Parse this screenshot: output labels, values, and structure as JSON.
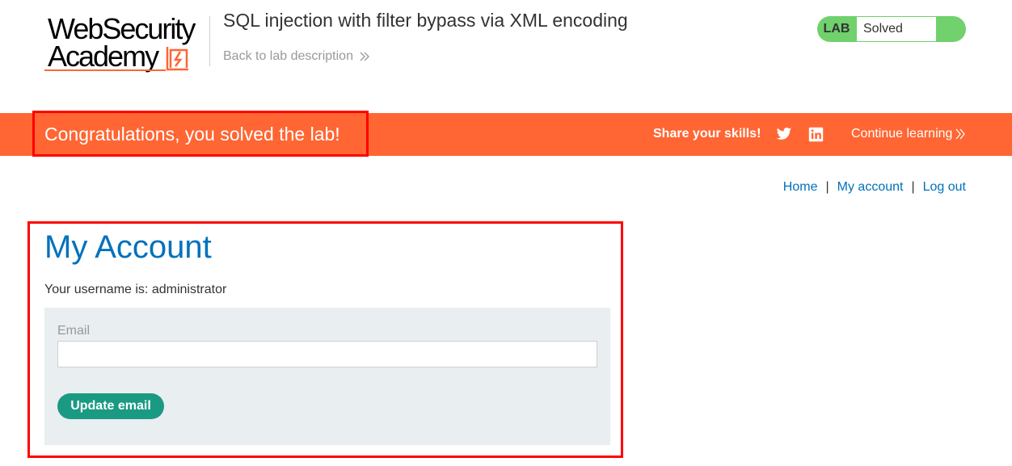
{
  "header": {
    "logo_line1": "WebSecurity",
    "logo_line2": "Academy",
    "lab_title": "SQL injection with filter bypass via XML encoding",
    "back_link": "Back to lab description",
    "lab_badge": "LAB",
    "lab_state": "Solved"
  },
  "banner": {
    "message": "Congratulations, you solved the lab!",
    "share_label": "Share your skills!",
    "continue_label": "Continue learning"
  },
  "nav": {
    "home": "Home",
    "sep1": "|",
    "my_account": "My account",
    "sep2": "|",
    "log_out": "Log out"
  },
  "main": {
    "title": "My Account",
    "username_line": "Your username is: administrator",
    "email_label": "Email",
    "email_value": "",
    "update_button": "Update email"
  },
  "colors": {
    "brand_orange": "#ff6633",
    "link_blue": "#0071bc",
    "solved_green": "#70d16d",
    "button_teal": "#1a9a83",
    "panel_bg": "#e9eef1",
    "highlight_red": "#ff0000"
  }
}
